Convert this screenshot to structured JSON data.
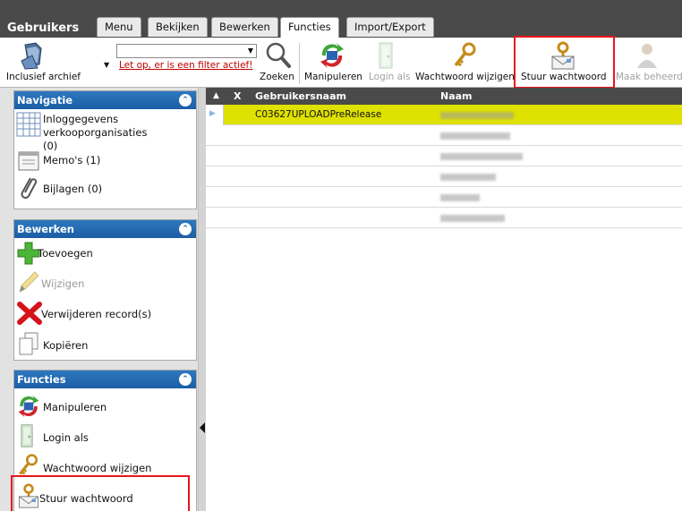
{
  "app": {
    "title": "Gebruikers"
  },
  "tabs": [
    {
      "label": "Menu"
    },
    {
      "label": "Bekijken"
    },
    {
      "label": "Bewerken"
    },
    {
      "label": "Functies"
    },
    {
      "label": "Import/Export"
    }
  ],
  "toolbar": {
    "include_archive": "Inclusief archief",
    "filter_warning": "Let op, er is een filter actief!",
    "search": "Zoeken",
    "manipulate": "Manipuleren",
    "login_as": "Login als",
    "change_password": "Wachtwoord wijzigen",
    "send_password": "Stuur wachtwoord",
    "make_admin": "Maak beheerde"
  },
  "panels": {
    "navigation": {
      "title": "Navigatie",
      "items": [
        {
          "label": "Inloggegevens\nverkooporganisaties (0)"
        },
        {
          "label": "Memo's (1)"
        },
        {
          "label": "Bijlagen (0)"
        }
      ]
    },
    "edit": {
      "title": "Bewerken",
      "items": [
        {
          "label": "Toevoegen"
        },
        {
          "label": "Wijzigen"
        },
        {
          "label": "Verwijderen record(s)"
        },
        {
          "label": "Kopiëren"
        }
      ]
    },
    "functions": {
      "title": "Functies",
      "items": [
        {
          "label": "Manipuleren"
        },
        {
          "label": "Login als"
        },
        {
          "label": "Wachtwoord wijzigen"
        },
        {
          "label": "Stuur wachtwoord"
        }
      ]
    }
  },
  "grid": {
    "columns": {
      "x": "X",
      "username": "Gebruikersnaam",
      "name": "Naam"
    },
    "rows": [
      {
        "username": "C03627UPLOADPreRelease"
      },
      {
        "username": ""
      },
      {
        "username": ""
      },
      {
        "username": ""
      },
      {
        "username": ""
      },
      {
        "username": ""
      }
    ]
  },
  "colors": {
    "header_dark": "#4a4a4a",
    "panel_header": "#1c5ea4",
    "selected_row": "#dfe100",
    "highlight_box": "#e8161c",
    "warning_text": "#c00000"
  }
}
